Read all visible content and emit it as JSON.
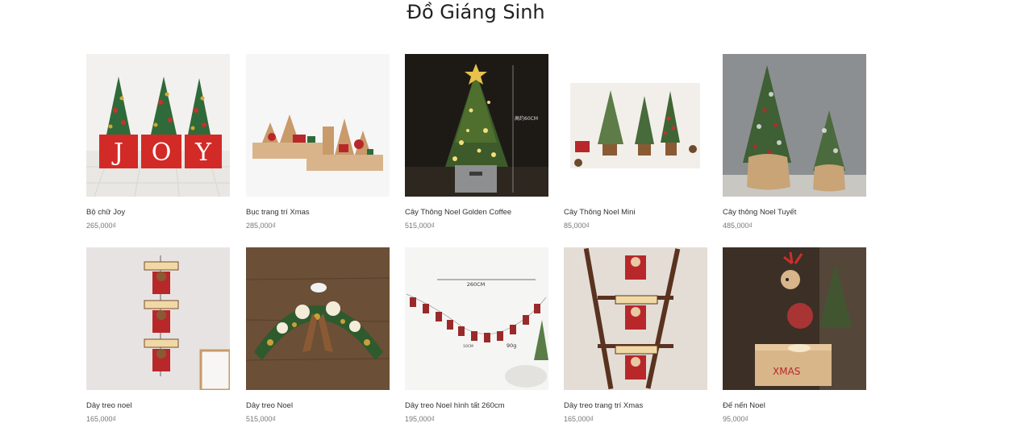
{
  "page": {
    "title": "Đồ Giáng Sinh"
  },
  "products": [
    {
      "name": "Bộ chữ Joy",
      "price": "265,000₫"
    },
    {
      "name": "Bục trang trí Xmas",
      "price": "285,000₫"
    },
    {
      "name": "Cây Thông Noel Golden Coffee",
      "price": "515,000₫"
    },
    {
      "name": "Cây Thông Noel Mini",
      "price": "85,000₫"
    },
    {
      "name": "Cây thông Noel Tuyết",
      "price": "485,000₫"
    },
    {
      "name": "Dây treo noel",
      "price": "165,000₫"
    },
    {
      "name": "Dây treo Noel",
      "price": "515,000₫"
    },
    {
      "name": "Dây treo Noel hình tất 260cm",
      "price": "195,000₫"
    },
    {
      "name": "Dây treo trang trí Xmas",
      "price": "165,000₫"
    },
    {
      "name": "Đế nến Noel",
      "price": "95,000₫"
    }
  ],
  "image_text": {
    "joy": [
      "J",
      "O",
      "Y"
    ],
    "tree_height": "高约60CM",
    "garland_length": "260CM",
    "sock_size": "10CM",
    "weight": "90g",
    "xmas_box": "XMAS"
  }
}
